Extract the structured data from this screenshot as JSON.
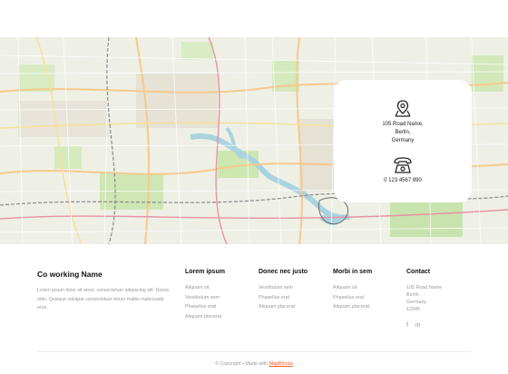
{
  "map": {
    "background": "#eef0e6"
  },
  "contact_card": {
    "address_lines": [
      "105 Road Name,",
      "Berlin,",
      "Germany"
    ],
    "phone": "0 123 4567 890",
    "location_icon": "map-location-icon",
    "phone_icon": "telephone-icon"
  },
  "footer": {
    "brand": "Co working Name",
    "description": "Lorem ipsum dolor sit amet, consectetuer adipiscing elit. Donec odio. Quisque volutpat consectetuer tetuer mattis malesuada eros.",
    "columns": [
      {
        "title": "Lorem ipsum",
        "links": [
          "Aliquam sit",
          "Vestibulum sem",
          "Phasellus erat",
          "Aliquam placerat"
        ]
      },
      {
        "title": "Donec nec justo",
        "links": [
          "Vestibulum sem",
          "Phasellus erat",
          "Aliquam placerat"
        ]
      },
      {
        "title": "Morbi in sem",
        "links": [
          "Aliquam sit",
          "Phasellus erat",
          "Aliquam placerat"
        ]
      }
    ],
    "contact": {
      "title": "Contact",
      "lines": [
        "105 Road Name",
        "Berlin",
        "Germany",
        "12345"
      ],
      "social": [
        {
          "icon": "facebook-icon",
          "glyph": "f"
        },
        {
          "icon": "linkedin-icon",
          "glyph": "in"
        }
      ]
    },
    "copyright_prefix": "© Copyright • Made with",
    "copyright_link": "MapBlocks",
    "link_color": "#ff5a1f"
  }
}
